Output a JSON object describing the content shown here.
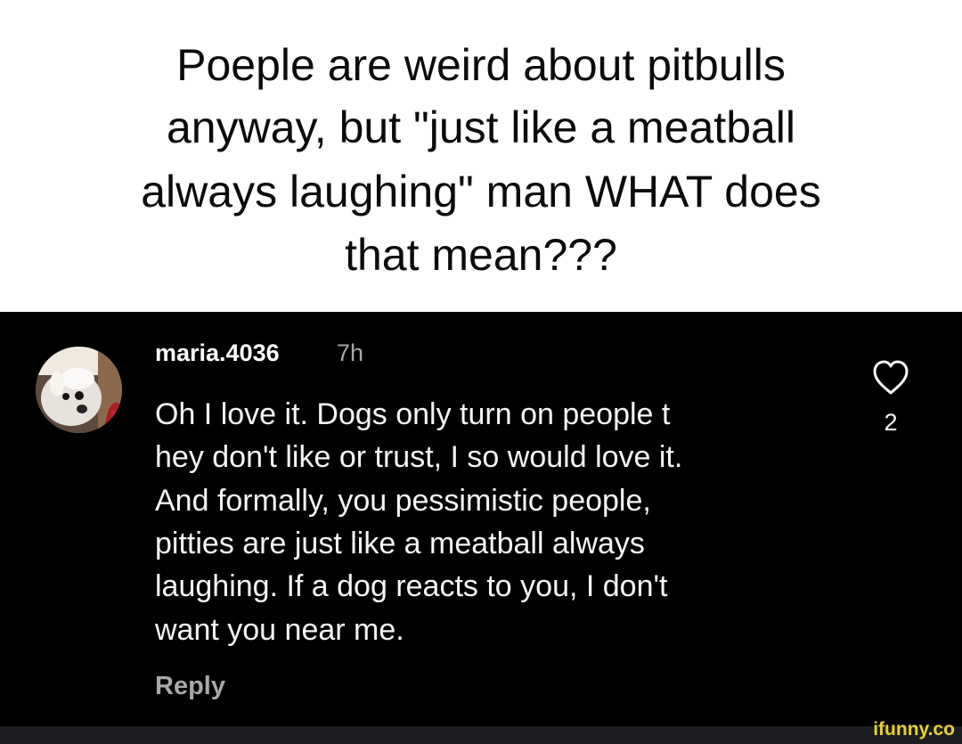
{
  "caption": {
    "lines": [
      "Poeple are weird about pitbulls",
      "anyway, but \"just like a meatball",
      "always laughing\" man WHAT does",
      "that mean???"
    ]
  },
  "comment": {
    "username": "maria.4036",
    "time": "7h",
    "text_lines": [
      "Oh I love it. Dogs only turn on people t",
      "hey don't like or trust, I so would love it.",
      "And formally, you pessimistic people,",
      "pitties are just like a meatball always",
      "laughing. If a dog reacts to you, I don't",
      "want you near me."
    ],
    "reply_label": "Reply",
    "like_count": "2",
    "like_icon": "heart-outline-icon"
  },
  "watermark": {
    "text": "ifunny.co"
  },
  "colors": {
    "caption_background": "#ffffff",
    "comment_background": "#000000",
    "comment_text": "#f5f5f5",
    "secondary_text": "#a8a8a8",
    "watermark": "#e7d12a"
  }
}
